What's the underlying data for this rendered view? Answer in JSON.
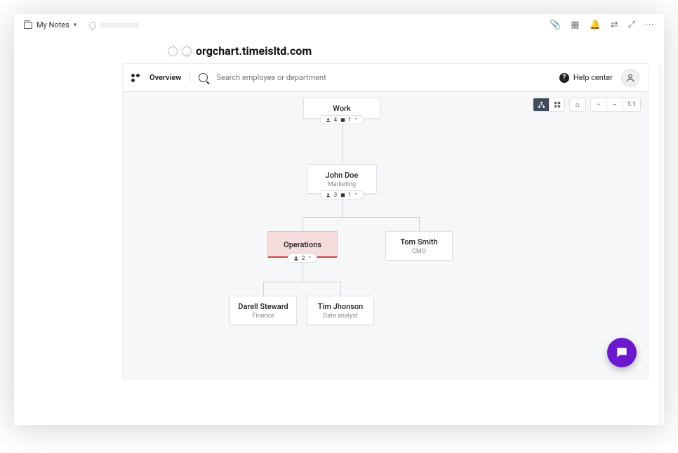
{
  "notes": {
    "folder_label": "My Notes"
  },
  "title": "orgchart.timeisltd.com",
  "toolbar": {
    "overview": "Overview",
    "search_placeholder": "Search employee or department",
    "help": "Help center",
    "zoom_label": "1:1"
  },
  "nodes": {
    "root": {
      "name": "Work",
      "people_count": "4",
      "dept_count": "1"
    },
    "n1": {
      "name": "John Doe",
      "sub": "Marketing",
      "people_count": "3",
      "dept_count": "1"
    },
    "n2a": {
      "name": "Operations",
      "people_count": "2"
    },
    "n2b": {
      "name": "Tom Smith",
      "sub": "CMO"
    },
    "n3a": {
      "name": "Darell Steward",
      "sub": "Finance"
    },
    "n3b": {
      "name": "Tim Jhonson",
      "sub": "Data analyst"
    }
  }
}
